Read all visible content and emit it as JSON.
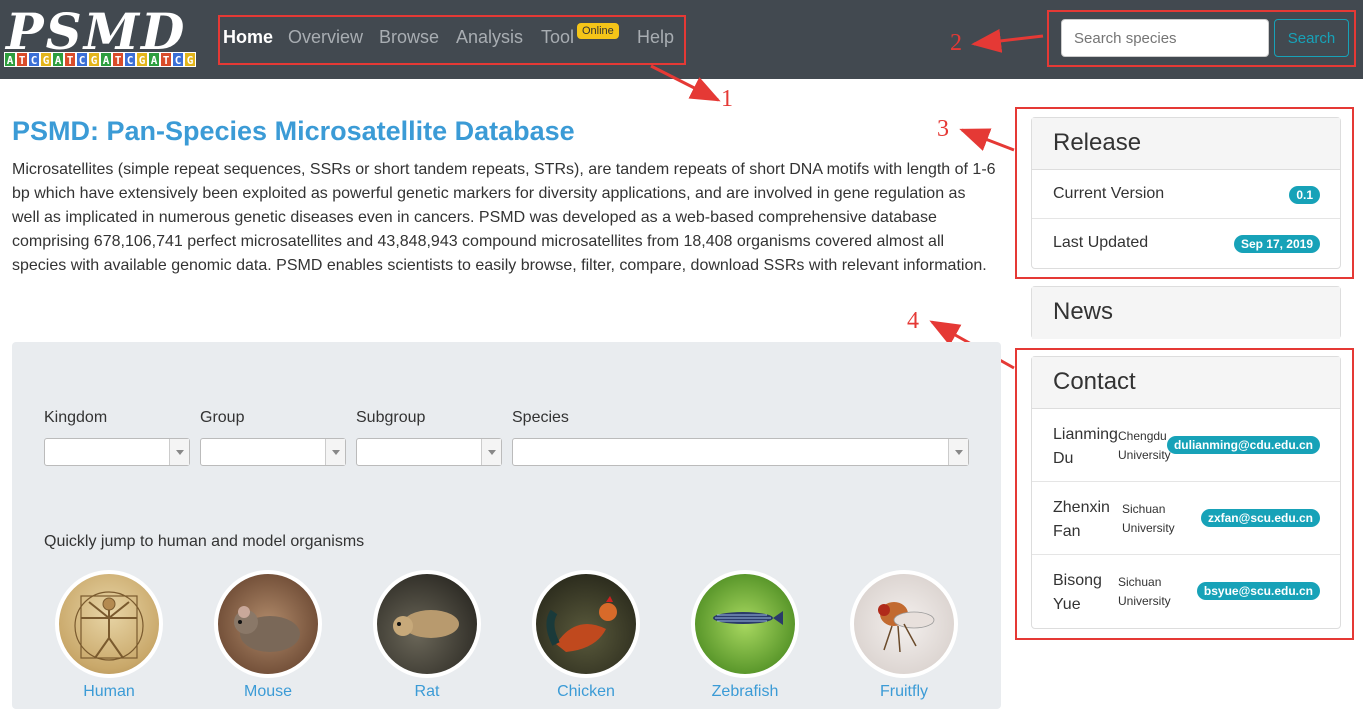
{
  "brand": {
    "logo_text": "PSMD",
    "dna_letters": [
      "A",
      "T",
      "C",
      "G",
      "A",
      "T",
      "C",
      "G",
      "A",
      "T",
      "C",
      "G",
      "A",
      "T",
      "C",
      "G"
    ],
    "dna_colors": {
      "A": "#2e9e3e",
      "T": "#d94c2a",
      "C": "#3b6fd6",
      "G": "#e3b51a"
    }
  },
  "nav": {
    "items": [
      "Home",
      "Overview",
      "Browse",
      "Analysis",
      "Tool",
      "Help"
    ],
    "active": "Home",
    "badge": "Online"
  },
  "search": {
    "placeholder": "Search species",
    "button": "Search"
  },
  "annotations": [
    "1",
    "2",
    "3",
    "4"
  ],
  "main": {
    "title": "PSMD: Pan-Species Microsatellite Database",
    "intro": "Microsatellites (simple repeat sequences, SSRs or short tandem repeats, STRs), are tandem repeats of short DNA motifs with length of 1-6 bp which have extensively been exploited as powerful genetic markers for diversity applications, and are involved in gene regulation as well as implicated in numerous genetic diseases even in cancers. PSMD was developed as a web-based comprehensive database comprising 678,106,741 perfect microsatellites and 43,848,943 compound microsatellites from 18,408 organisms covered almost all species with available genomic data. PSMD enables scientists to easily browse, filter, compare, download SSRs with relevant information."
  },
  "filters": {
    "labels": [
      "Kingdom",
      "Group",
      "Subgroup",
      "Species"
    ],
    "quick_jump_label": "Quickly jump to human and model organisms"
  },
  "organisms": [
    "Human",
    "Mouse",
    "Rat",
    "Chicken",
    "Zebrafish",
    "Fruitfly"
  ],
  "release": {
    "title": "Release",
    "rows": [
      {
        "label": "Current Version",
        "value": "0.1"
      },
      {
        "label": "Last Updated",
        "value": "Sep 17, 2019"
      }
    ]
  },
  "news": {
    "title": "News"
  },
  "contact": {
    "title": "Contact",
    "people": [
      {
        "name": "Lianming Du",
        "org": "Chengdu University",
        "email": "dulianming@cdu.edu.cn"
      },
      {
        "name": "Zhenxin Fan",
        "org": "Sichuan University",
        "email": "zxfan@scu.edu.cn"
      },
      {
        "name": "Bisong Yue",
        "org": "Sichuan University",
        "email": "bsyue@scu.edu.cn"
      }
    ]
  },
  "colors": {
    "navbar": "#424950",
    "accent": "#17a2b8",
    "link": "#3b9bd6",
    "annotation": "#e53935",
    "badge": "#f5c518"
  }
}
